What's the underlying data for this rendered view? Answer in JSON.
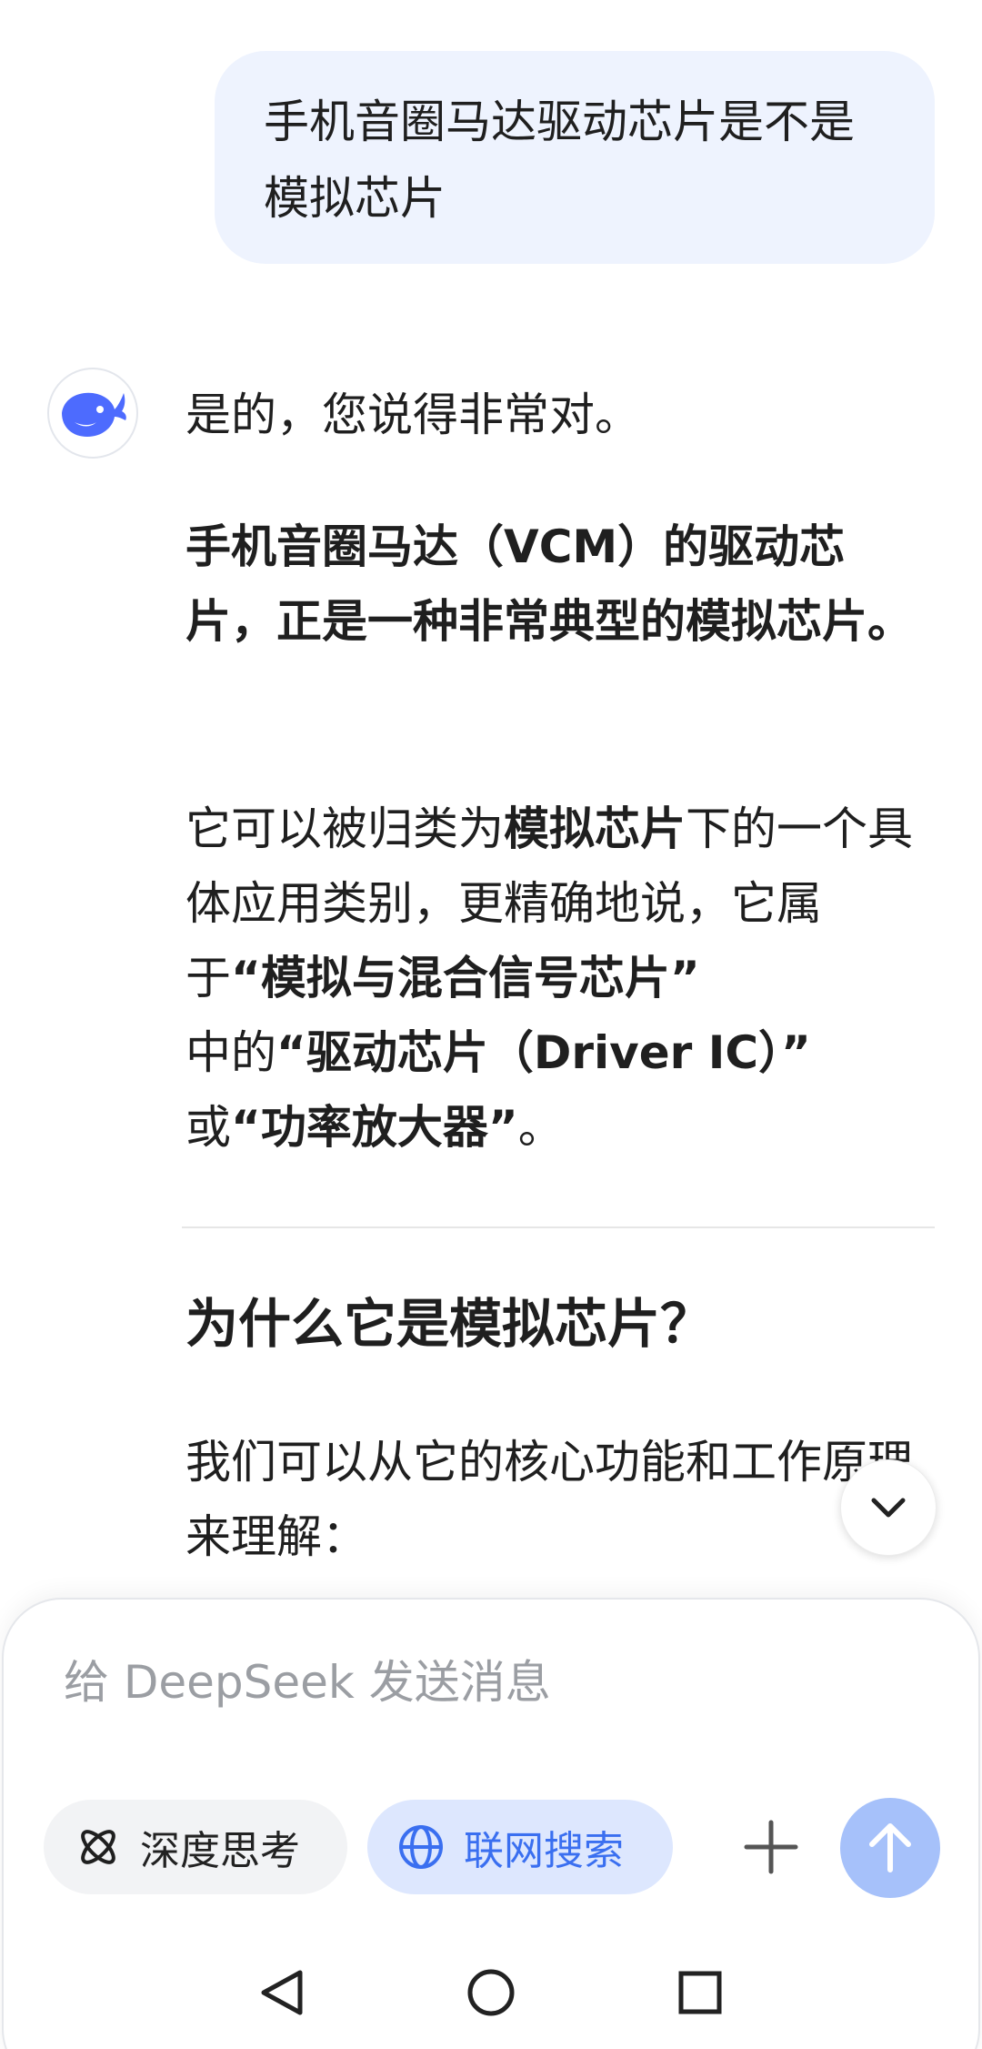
{
  "conversation": {
    "user_message": "手机音圈马达驱动芯片是不是模拟芯片",
    "assistant": {
      "intro": "是的，您说得非常对。",
      "strong_statement": "手机音圈马达（VCM）的驱动芯片，正是一种非常典型的模拟芯片。",
      "body": {
        "t1": "它可以被归类为",
        "b1": "模拟芯片",
        "t2": "下的一个具体应用类别，更精确地说，它属于",
        "b2": "“模拟与混合信号芯片”",
        "t3": "中的",
        "b3": "“驱动芯片（Driver IC）”",
        "t4": "或",
        "b4": "“功率放大器”",
        "t5": "。"
      },
      "section_heading": "为什么它是模拟芯片？",
      "section_text": "我们可以从它的核心功能和工作原理来理解："
    }
  },
  "composer": {
    "placeholder": "给 DeepSeek 发送消息",
    "deep_think_label": "深度思考",
    "web_search_label": "联网搜索"
  },
  "colors": {
    "user_bubble": "#eef3fe",
    "accent_blue": "#3a6ff0",
    "search_pill_bg": "#dde7fe",
    "send_button": "#a6c1fa",
    "logo_blue": "#4d6bfe"
  },
  "icons": {
    "avatar": "deepseek-whale-icon",
    "scroll": "chevron-down-icon",
    "deep_think": "atom-icon",
    "web_search": "globe-icon",
    "attach": "plus-icon",
    "send": "arrow-up-icon",
    "nav_back": "triangle-back-icon",
    "nav_home": "circle-home-icon",
    "nav_recents": "square-recents-icon"
  }
}
